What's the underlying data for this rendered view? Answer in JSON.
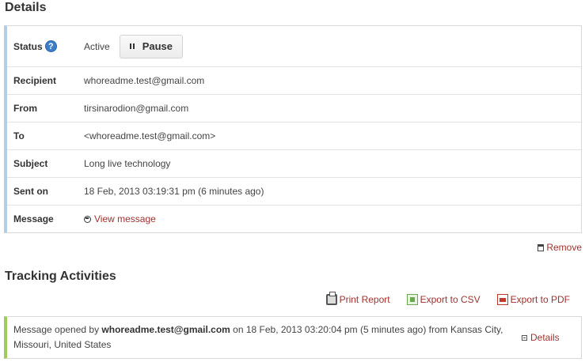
{
  "details": {
    "title": "Details",
    "rows": [
      {
        "label": "Status",
        "value": "Active"
      },
      {
        "label": "Recipient",
        "value": "whoreadme.test@gmail.com"
      },
      {
        "label": "From",
        "value": "tirsinarodion@gmail.com"
      },
      {
        "label": "To",
        "value": "<whoreadme.test@gmail.com>"
      },
      {
        "label": "Subject",
        "value": "Long live technology"
      },
      {
        "label": "Sent on",
        "value": "18 Feb, 2013 03:19:31 pm (6 minutes ago)"
      },
      {
        "label": "Message",
        "value": "View message"
      }
    ],
    "pause_label": "Pause",
    "help_glyph": "?",
    "remove_label": "Remove"
  },
  "tracking": {
    "title": "Tracking Activities",
    "toolbar": {
      "print_label": "Print Report",
      "csv_label": "Export to CSV",
      "pdf_label": "Export to PDF"
    },
    "activity": {
      "prefix": "Message opened by ",
      "email": "whoreadme.test@gmail.com",
      "suffix": " on 18 Feb, 2013 03:20:04 pm (5 minutes ago) from Kansas City, Missouri, United States",
      "details_label": "Details"
    }
  },
  "colors": {
    "link": "#a1312e",
    "details_accent": "#b3cfe8",
    "activity_accent": "#9ccc5a",
    "help_icon": "#3c7fc8"
  },
  "icons": [
    "help-icon",
    "pause-icon",
    "message-icon",
    "trash-icon",
    "printer-icon",
    "csv-icon",
    "pdf-icon",
    "expand-icon"
  ]
}
